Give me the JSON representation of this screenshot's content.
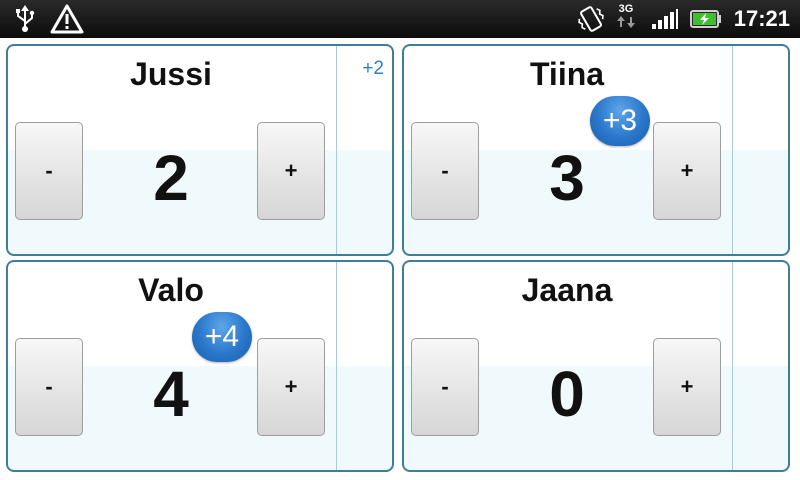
{
  "status_bar": {
    "network": "3G",
    "time": "17:21",
    "icons": [
      "usb-icon",
      "warning-icon",
      "vibrate-icon",
      "network-3g-icon",
      "signal-icon",
      "battery-charging-icon"
    ]
  },
  "players": [
    {
      "name": "Jussi",
      "score": "2",
      "delta": "+2",
      "minus_label": "-",
      "plus_label": "+"
    },
    {
      "name": "Tiina",
      "score": "3",
      "delta": "+3",
      "minus_label": "-",
      "plus_label": "+"
    },
    {
      "name": "Valo",
      "score": "4",
      "delta": "+4",
      "minus_label": "-",
      "plus_label": "+"
    },
    {
      "name": "Jaana",
      "score": "0",
      "minus_label": "-",
      "plus_label": "+"
    }
  ],
  "colors": {
    "card_border": "#3f7f96",
    "badge": "#2a77cc",
    "delta_text": "#2d7fd6",
    "status_bar": "#0c0c0c",
    "battery_charge": "#3fbf2f"
  }
}
